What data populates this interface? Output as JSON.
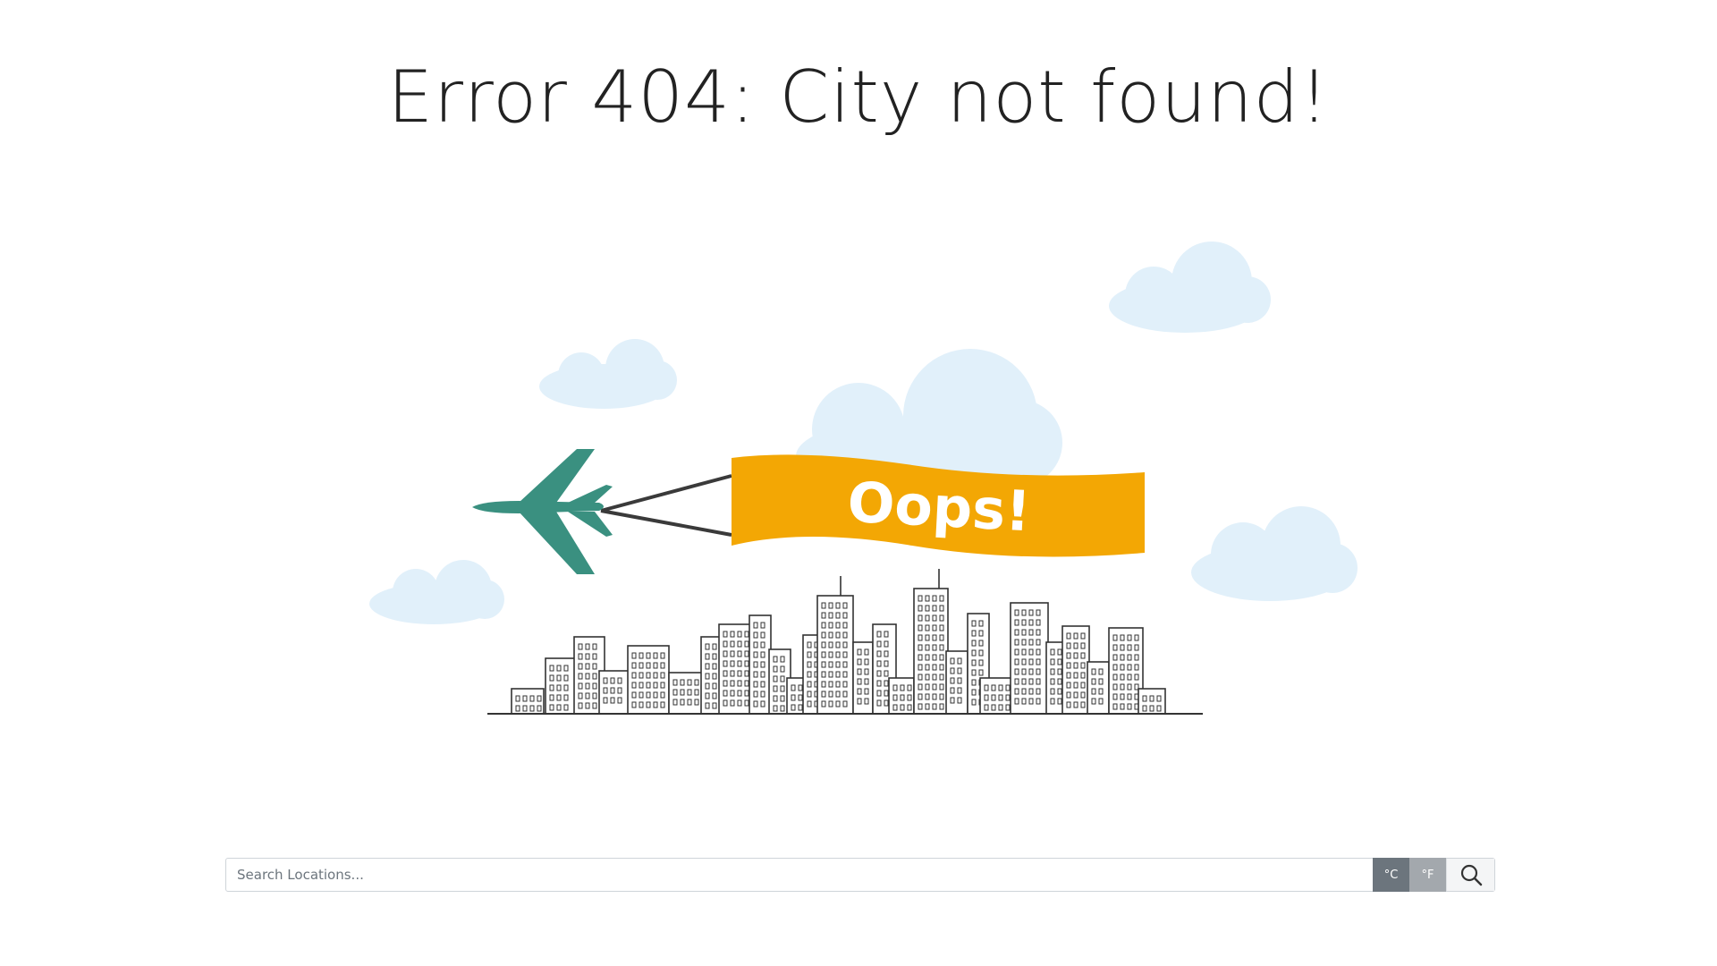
{
  "page": {
    "title": "Error 404: City not found!"
  },
  "illustration": {
    "banner_text": "Oops!",
    "colors": {
      "banner": "#f3a704",
      "plane": "#3a9080",
      "cloud": "#e1f0fa",
      "ink": "#333333"
    }
  },
  "search": {
    "placeholder": "Search Locations...",
    "value": "",
    "unit_c_label": "°C",
    "unit_f_label": "°F",
    "search_icon": "search-icon"
  }
}
